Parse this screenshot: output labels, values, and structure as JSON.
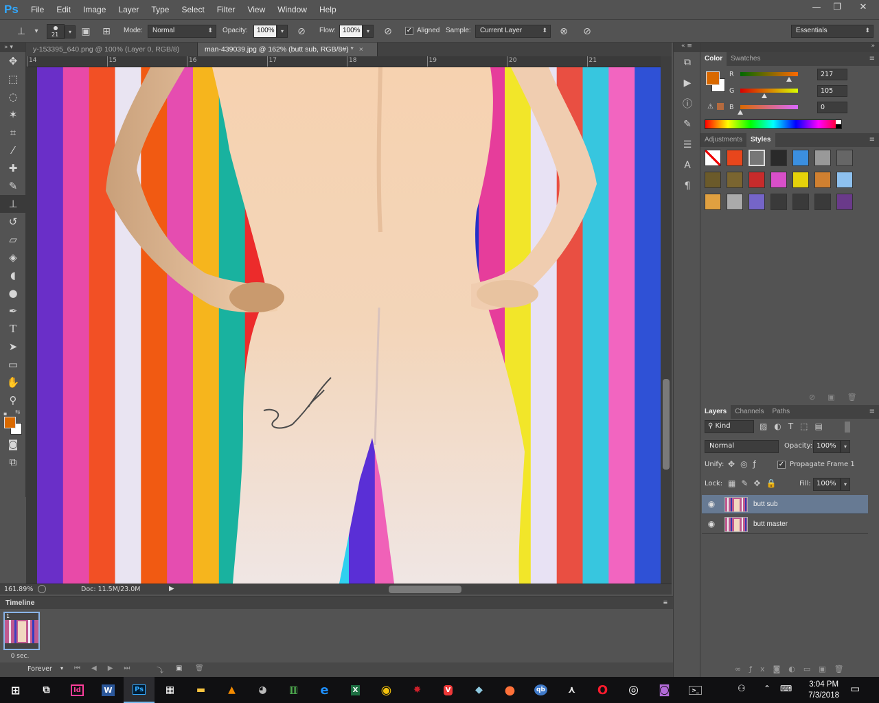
{
  "app": {
    "logo": "Ps"
  },
  "menu": [
    "File",
    "Edit",
    "Image",
    "Layer",
    "Type",
    "Select",
    "Filter",
    "View",
    "Window",
    "Help"
  ],
  "window_controls": {
    "minimize": "—",
    "restore": "❐",
    "close": "✕"
  },
  "options_bar": {
    "brush_size": "21",
    "mode_label": "Mode:",
    "mode_value": "Normal",
    "opacity_label": "Opacity:",
    "opacity_value": "100%",
    "flow_label": "Flow:",
    "flow_value": "100%",
    "aligned_label": "Aligned",
    "sample_label": "Sample:",
    "sample_value": "Current Layer",
    "workspace": "Essentials"
  },
  "doc_tabs": [
    {
      "label": "y-153395_640.png @ 100% (Layer 0, RGB/8)",
      "active": false
    },
    {
      "label": "man-439039.jpg @ 162% (butt sub, RGB/8#) *",
      "active": true
    }
  ],
  "ruler_top": [
    "14",
    "15",
    "16",
    "17",
    "18",
    "19",
    "20",
    "21"
  ],
  "status": {
    "zoom": "161.89%",
    "doc": "Doc: 11.5M/23.0M"
  },
  "timeline": {
    "title": "Timeline",
    "frame_number": "1",
    "frame_delay": "0 sec.",
    "loop": "Forever"
  },
  "color_panel": {
    "tabs": [
      "Color",
      "Swatches"
    ],
    "foreground": "#d96900",
    "r_label": "R",
    "g_label": "G",
    "b_label": "B",
    "r": 217,
    "g": 105,
    "b": 0,
    "r_value": "217",
    "g_value": "105",
    "b_value": "0"
  },
  "styles_panel": {
    "tabs": [
      "Adjustments",
      "Styles"
    ]
  },
  "layers_panel": {
    "tabs": [
      "Layers",
      "Channels",
      "Paths"
    ],
    "kind_label": "Kind",
    "blend_mode": "Normal",
    "opacity_label": "Opacity:",
    "opacity_value": "100%",
    "unify_label": "Unify:",
    "propagate_label": "Propagate Frame 1",
    "lock_label": "Lock:",
    "fill_label": "Fill:",
    "fill_value": "100%",
    "layers": [
      {
        "name": "butt sub",
        "selected": true
      },
      {
        "name": "butt master",
        "selected": false
      }
    ]
  },
  "taskbar": {
    "time": "3:04 PM",
    "date": "7/3/2018"
  },
  "colors": {
    "accent": "#31a8ff",
    "selection": "#677a93"
  }
}
